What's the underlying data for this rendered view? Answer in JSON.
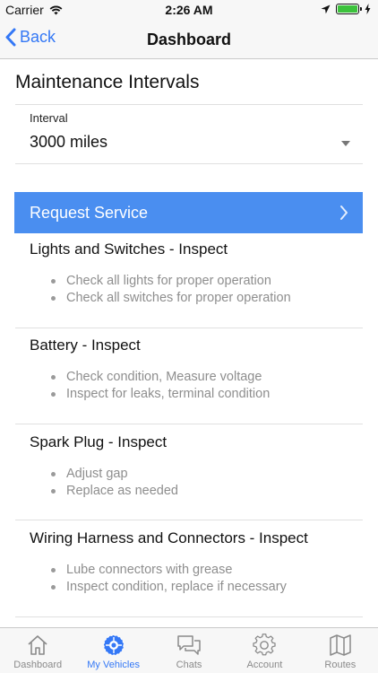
{
  "status": {
    "carrier": "Carrier",
    "time": "2:26 AM"
  },
  "nav": {
    "back_label": "Back",
    "title": "Dashboard"
  },
  "maintenance": {
    "title": "Maintenance Intervals",
    "interval_label": "Interval",
    "interval_value": "3000 miles"
  },
  "request": {
    "label": "Request Service"
  },
  "tasks": [
    {
      "title": "Lights and Switches - Inspect",
      "items": [
        "Check all lights for proper operation",
        "Check all switches for proper operation"
      ]
    },
    {
      "title": "Battery - Inspect",
      "items": [
        "Check condition, Measure voltage",
        "Inspect for leaks, terminal condition"
      ]
    },
    {
      "title": "Spark Plug - Inspect",
      "items": [
        "Adjust gap",
        "Replace as needed"
      ]
    },
    {
      "title": "Wiring Harness and Connectors - Inspect",
      "items": [
        "Lube connectors with grease",
        "Inspect condition, replace if necessary"
      ]
    }
  ],
  "tabs": [
    {
      "label": "Dashboard",
      "icon": "house-icon"
    },
    {
      "label": "My Vehicles",
      "icon": "wheel-icon",
      "active": true
    },
    {
      "label": "Chats",
      "icon": "chat-bubbles-icon"
    },
    {
      "label": "Account",
      "icon": "gear-icon"
    },
    {
      "label": "Routes",
      "icon": "map-icon"
    }
  ],
  "colors": {
    "accent": "#3478f6",
    "request_button": "#4a8ef0",
    "battery": "#3cc23c",
    "muted_text": "#8e8e8e"
  }
}
